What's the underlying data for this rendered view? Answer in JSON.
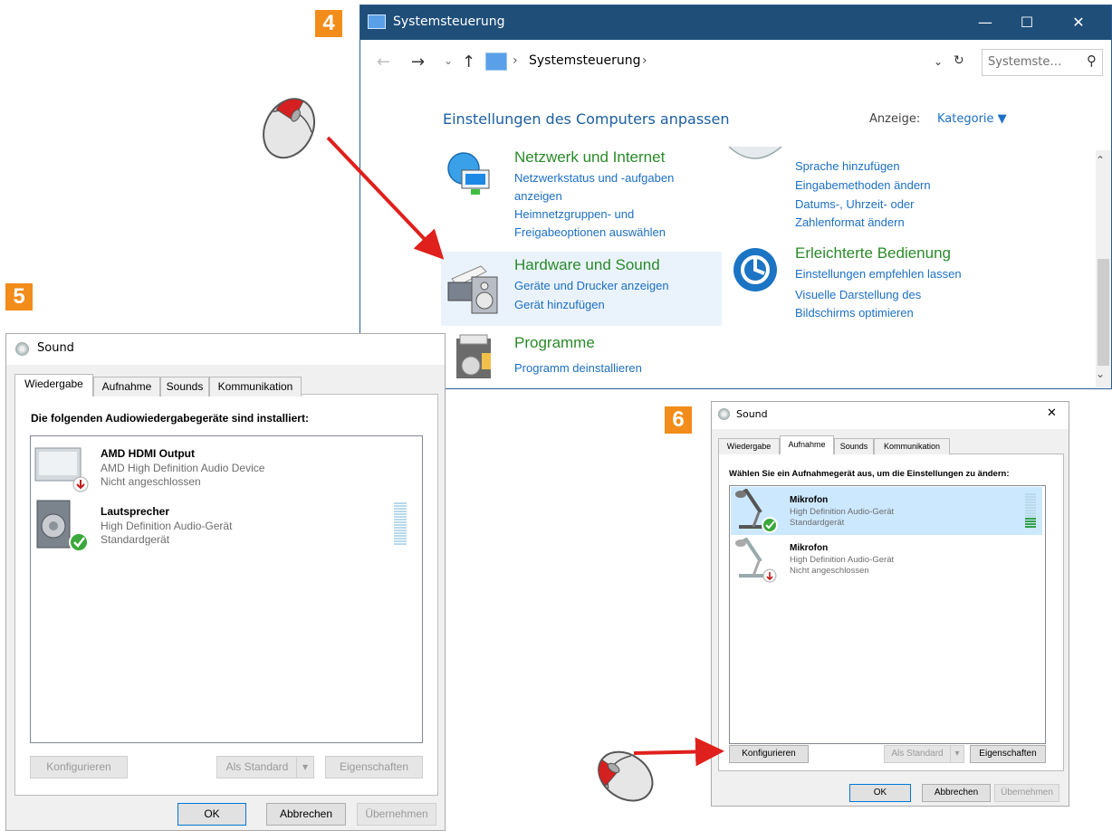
{
  "steps": [
    "4",
    "5",
    "6"
  ],
  "control_panel": {
    "title": "Systemsteuerung",
    "minimize": "—",
    "maximize": "☐",
    "close": "✕",
    "nav": {
      "back": "←",
      "forward": "→",
      "recent": "⌄",
      "up": "↑"
    },
    "breadcrumb_sep": "›",
    "breadcrumb": "Systemsteuerung",
    "breadcrumb_trailing": "›",
    "refresh": "↻",
    "dropdown": "⌄",
    "search_placeholder": "Systemste…",
    "search_icon": "⚲",
    "heading": "Einstellungen des Computers anpassen",
    "view_label": "Anzeige:",
    "view_value": "Kategorie ▼",
    "categories": {
      "network": {
        "title": "Netzwerk und Internet",
        "links": [
          "Netzwerkstatus und -aufgaben anzeigen",
          "Heimnetzgruppen- und Freigabeoptionen auswählen"
        ]
      },
      "language": {
        "links": [
          "Sprache hinzufügen",
          "Eingabemethoden ändern",
          "Datums-, Uhrzeit- oder Zahlenformat ändern"
        ]
      },
      "hardware": {
        "title": "Hardware und Sound",
        "links": [
          "Geräte und Drucker anzeigen",
          "Gerät hinzufügen"
        ]
      },
      "ease": {
        "title": "Erleichterte Bedienung",
        "links": [
          "Einstellungen empfehlen lassen",
          "Visuelle Darstellung des Bildschirms optimieren"
        ]
      },
      "programs": {
        "title": "Programme",
        "links": [
          "Programm deinstallieren"
        ]
      }
    },
    "scroll_up": "⌃",
    "scroll_down": "⌄"
  },
  "sound5": {
    "title": "Sound",
    "tabs": [
      "Wiedergabe",
      "Aufnahme",
      "Sounds",
      "Kommunikation"
    ],
    "active_tab": "Wiedergabe",
    "instruction": "Die folgenden Audiowiedergabegeräte sind installiert:",
    "devices": [
      {
        "name": "AMD HDMI Output",
        "line1": "AMD High Definition Audio Device",
        "line2": "Nicht angeschlossen",
        "status": "disconnected"
      },
      {
        "name": "Lautsprecher",
        "line1": "High Definition Audio-Gerät",
        "line2": "Standardgerät",
        "status": "default"
      }
    ],
    "buttons": {
      "configure": "Konfigurieren",
      "set_default": "Als Standard",
      "properties": "Eigenschaften",
      "ok": "OK",
      "cancel": "Abbrechen",
      "apply": "Übernehmen"
    }
  },
  "sound6": {
    "title": "Sound",
    "close": "✕",
    "tabs": [
      "Wiedergabe",
      "Aufnahme",
      "Sounds",
      "Kommunikation"
    ],
    "active_tab": "Aufnahme",
    "instruction": "Wählen Sie ein Aufnahmegerät aus, um die Einstellungen zu ändern:",
    "devices": [
      {
        "name": "Mikrofon",
        "line1": "High Definition Audio-Gerät",
        "line2": "Standardgerät",
        "status": "default",
        "selected": true
      },
      {
        "name": "Mikrofon",
        "line1": "High Definition Audio-Gerät",
        "line2": "Nicht angeschlossen",
        "status": "disconnected",
        "selected": false
      }
    ],
    "buttons": {
      "configure": "Konfigurieren",
      "set_default": "Als Standard",
      "properties": "Eigenschaften",
      "ok": "OK",
      "cancel": "Abbrechen",
      "apply": "Übernehmen"
    }
  },
  "colors": {
    "accent": "#f28c1a",
    "titlebar": "#1f4e79",
    "link": "#1c6fc4",
    "category": "#2a8a2a",
    "arrow": "#e0201c",
    "selection": "#cce8ff"
  }
}
